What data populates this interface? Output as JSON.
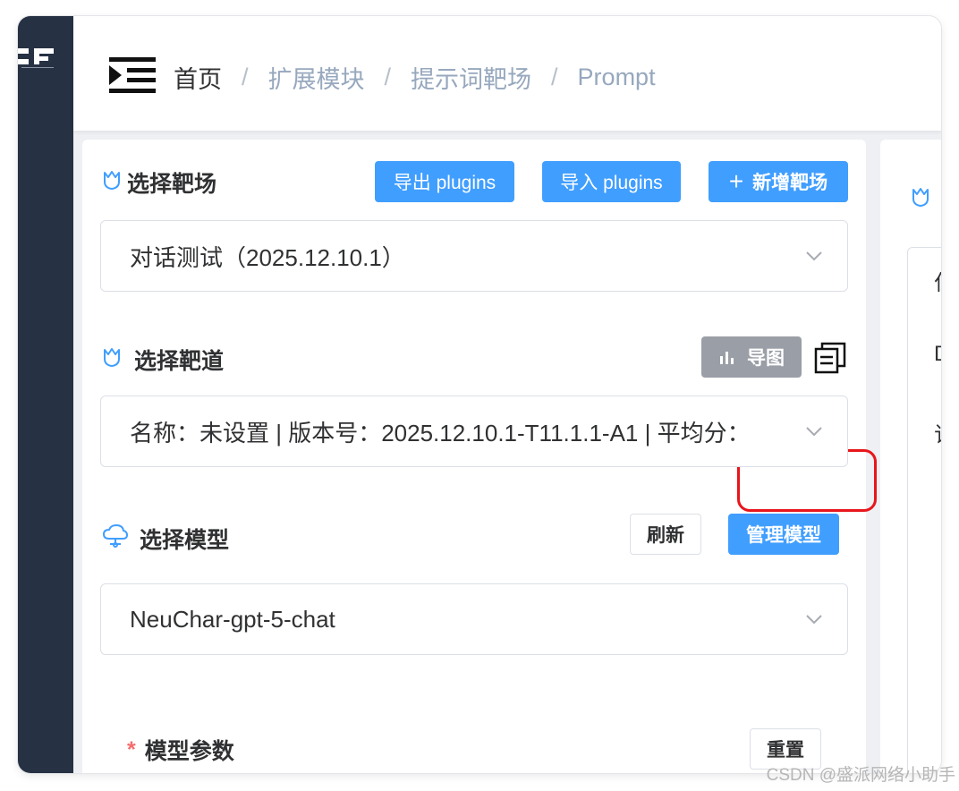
{
  "breadcrumb": {
    "home": "首页",
    "sep": "/",
    "items": [
      "扩展模块",
      "提示词靶场",
      "Prompt"
    ]
  },
  "range_section": {
    "title": "选择靶场",
    "export_label": "导出 plugins",
    "import_label": "导入 plugins",
    "add_label": "新增靶场",
    "add_icon": "+",
    "selected": "对话测试（2025.12.10.1）"
  },
  "lane_section": {
    "title": "选择靶道",
    "chart_label": "导图",
    "selected": "名称：未设置 | 版本号：2025.12.10.1-T11.1.1-A1 | 平均分："
  },
  "model_section": {
    "title": "选择模型",
    "refresh_label": "刷新",
    "manage_label": "管理模型",
    "selected": "NeuChar-gpt-5-chat"
  },
  "params_section": {
    "required_mark": "*",
    "title": "模型参数",
    "reset_label": "重置"
  },
  "right_panel": {
    "chars": [
      "仁",
      "D",
      "订"
    ]
  },
  "watermark": "CSDN @盛派网络小助手",
  "colors": {
    "primary": "#409eff",
    "sidebar": "#263143",
    "highlight": "#e8161c",
    "muted_button": "#9a9ea6"
  }
}
